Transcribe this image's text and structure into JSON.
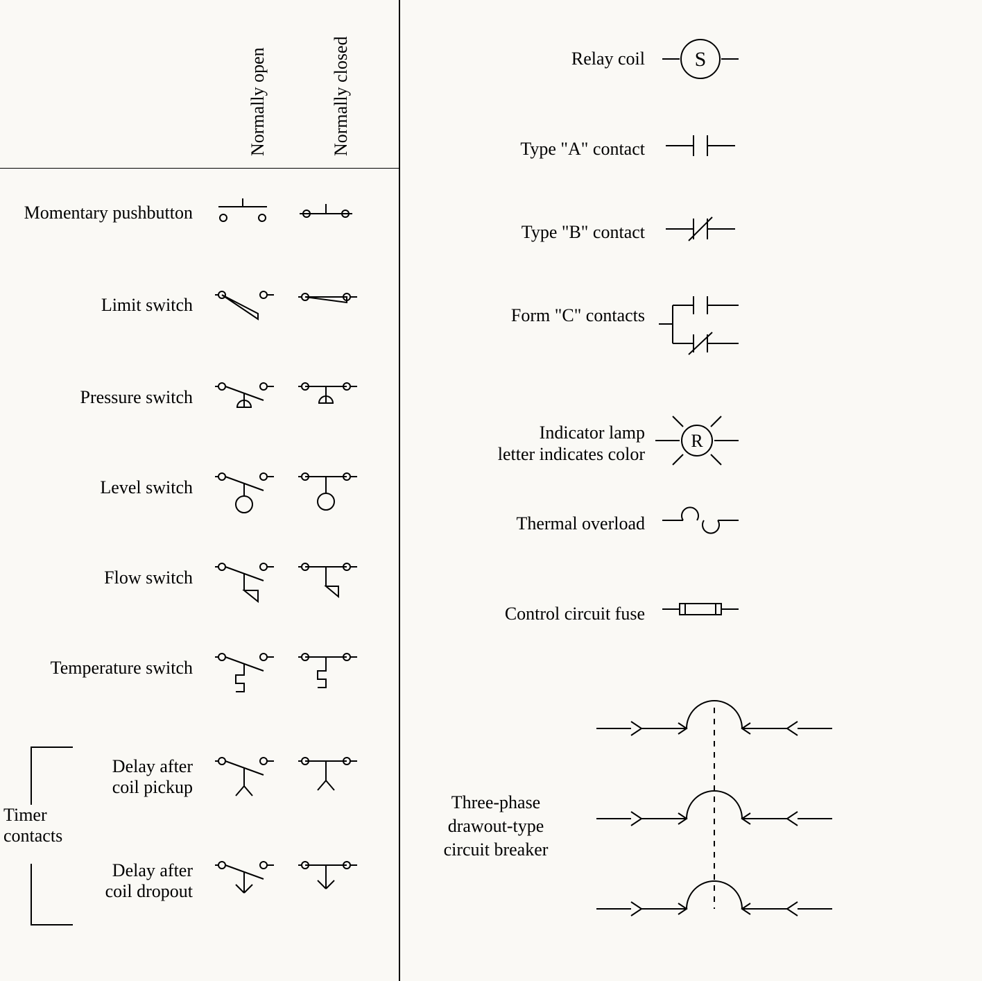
{
  "columns": {
    "normally_open": "Normally open",
    "normally_closed": "Normally closed"
  },
  "rows": {
    "momentary_pushbutton": "Momentary pushbutton",
    "limit_switch": "Limit switch",
    "pressure_switch": "Pressure switch",
    "level_switch": "Level switch",
    "flow_switch": "Flow switch",
    "temperature_switch": "Temperature switch",
    "delay_after_coil_pickup": "Delay after\ncoil pickup",
    "delay_after_coil_dropout": "Delay after\ncoil dropout"
  },
  "timer_group_label": "Timer\ncontacts",
  "right": {
    "relay_coil": "Relay coil",
    "relay_coil_letter": "S",
    "type_a_contact": "Type \"A\" contact",
    "type_b_contact": "Type \"B\" contact",
    "form_c_contacts": "Form \"C\" contacts",
    "indicator_lamp": "Indicator lamp\nletter indicates color",
    "indicator_lamp_letter": "R",
    "thermal_overload": "Thermal overload",
    "control_circuit_fuse": "Control circuit fuse",
    "three_phase_breaker": "Three-phase\ndrawout-type\ncircuit breaker"
  }
}
